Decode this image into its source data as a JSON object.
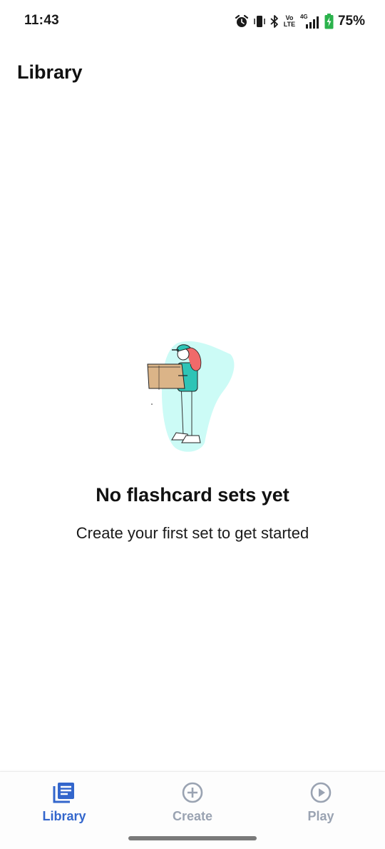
{
  "status_bar": {
    "time": "11:43",
    "volte_top": "Vo",
    "volte_bottom": "LTE",
    "network": "4G",
    "battery_percent": "75%",
    "battery_color": "#2bb24c"
  },
  "header": {
    "title": "Library"
  },
  "empty_state": {
    "title": "No flashcard sets yet",
    "subtitle": "Create your first set to get started"
  },
  "bottom_nav": {
    "items": [
      {
        "label": "Library",
        "icon": "library-icon",
        "active": true
      },
      {
        "label": "Create",
        "icon": "add-circle-icon",
        "active": false
      },
      {
        "label": "Play",
        "icon": "play-circle-icon",
        "active": false
      }
    ],
    "active_color": "#3366cc",
    "inactive_color": "#9aa3b2"
  }
}
